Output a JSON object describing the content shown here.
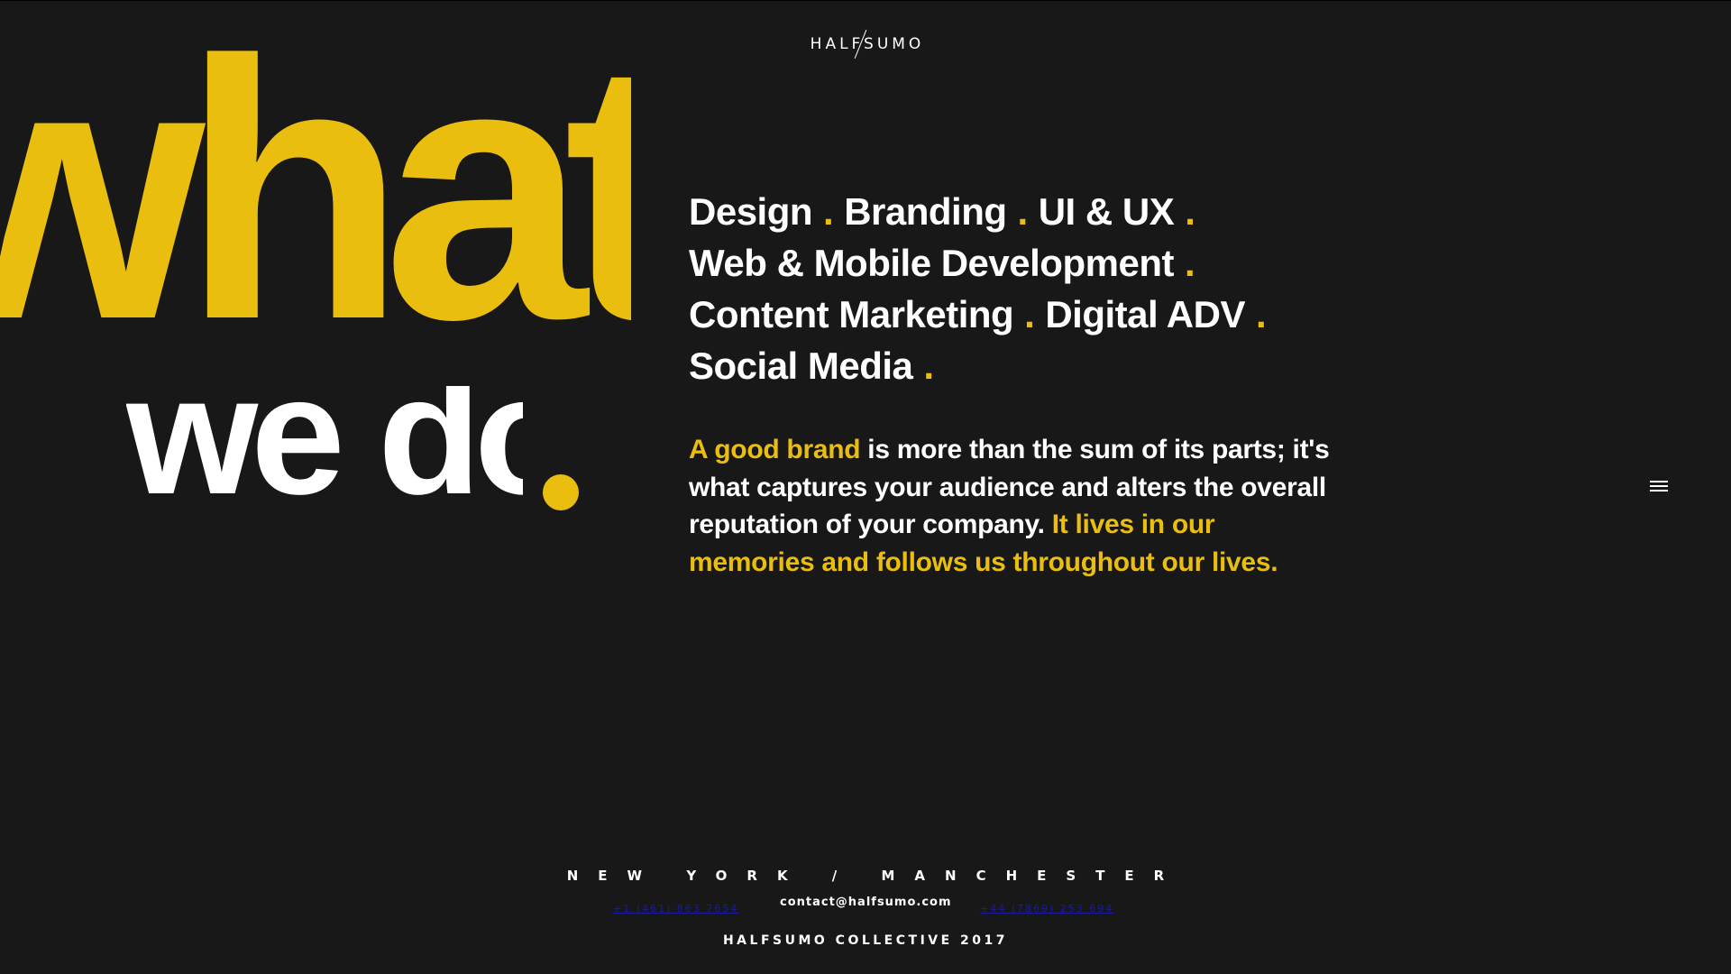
{
  "header": {
    "logo_text": "HALFSUMO"
  },
  "hero": {
    "big_word": "what",
    "sub_word": "we do"
  },
  "services": {
    "lines": [
      [
        "Design",
        "Branding",
        "UI & UX"
      ],
      [
        "Web & Mobile Development"
      ],
      [
        "Content Marketing",
        "Digital ADV"
      ],
      [
        "Social Media"
      ]
    ],
    "separator": "."
  },
  "intro": {
    "highlight_1": "A good brand",
    "text_1": " is more than the sum of its parts; it's what captures your audience and alters the overall reputation of your company. ",
    "highlight_2": "It lives in our memories and follows us throughout our lives."
  },
  "nav": {
    "menu_icon": "hamburger-menu-icon"
  },
  "footer": {
    "cities": "NEW YORK / MANCHESTER",
    "phone_1": "+1 (461) 863 7654",
    "email": "contact@halfsumo.com",
    "phone_2": "+44 (7869) 253 694",
    "copyright": "HALFSUMO COLLECTIVE 2017"
  },
  "colors": {
    "background": "#181818",
    "accent": "#eabe0f",
    "text": "#ffffff",
    "link": "#1a1aa6"
  }
}
